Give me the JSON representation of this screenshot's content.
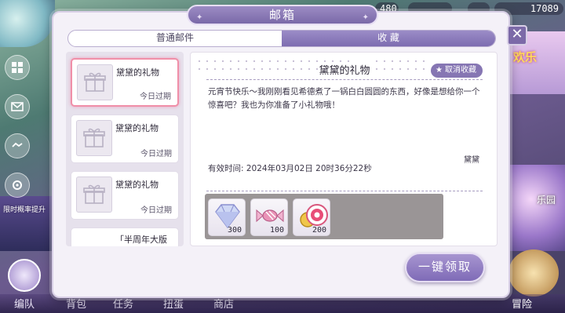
{
  "background": {
    "resources": [
      "480",
      "",
      "",
      "17089"
    ],
    "left_banner": "限时概率提升",
    "right_banner": "欢乐",
    "right_label": "乐园",
    "bottom_nav": [
      "编队",
      "背包",
      "任务",
      "扭蛋",
      "商店",
      "冒险"
    ]
  },
  "dialog": {
    "title": "邮箱",
    "tabs": [
      {
        "label": "普通邮件",
        "active": false
      },
      {
        "label": "收 藏",
        "active": true
      }
    ],
    "mails": [
      {
        "title": "黛黛的礼物",
        "expire": "今日过期",
        "selected": true
      },
      {
        "title": "黛黛的礼物",
        "expire": "今日过期",
        "selected": false
      },
      {
        "title": "黛黛的礼物",
        "expire": "今日过期",
        "selected": false
      },
      {
        "title": "「半周年大版",
        "expire": "",
        "selected": false
      }
    ],
    "detail": {
      "title": "黛黛的礼物",
      "unfavorite_label": "取消收藏",
      "body": "元宵节快乐～我刚刚看见希德煮了一锅白白圆圆的东西，好像是想给你一个惊喜吧？我也为你准备了小礼物哦！",
      "sender": "黛黛",
      "validity": "有效时间: 2024年03月02日  20时36分22秒",
      "attachments": [
        {
          "icon": "diamond-icon",
          "qty": "300"
        },
        {
          "icon": "candy-icon",
          "qty": "100"
        },
        {
          "icon": "gold-coin-icon",
          "qty": "200"
        }
      ]
    },
    "claim_all_label": "一键领取"
  }
}
